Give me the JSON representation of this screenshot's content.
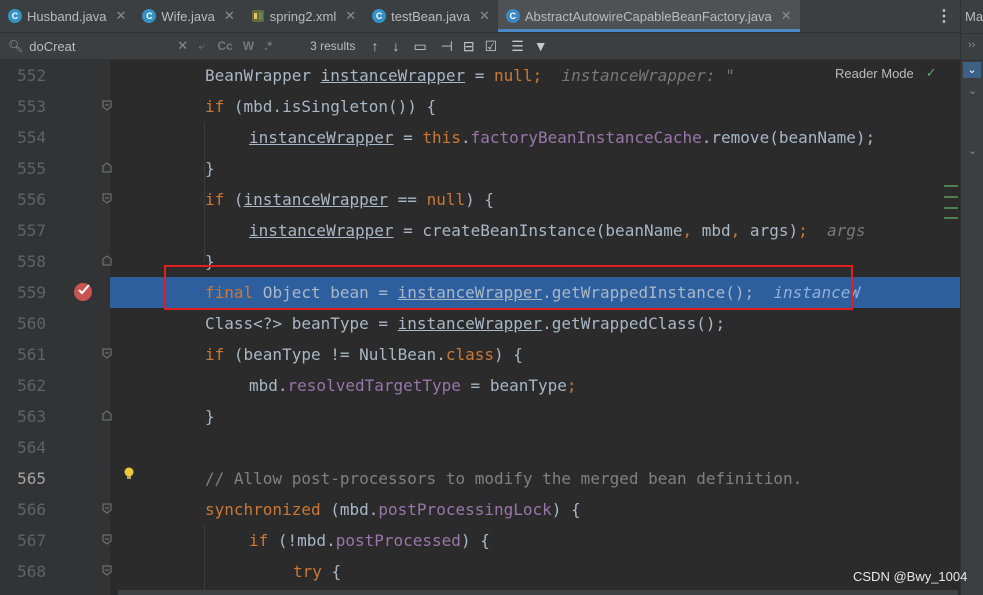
{
  "tabs": [
    {
      "label": "Husband.java",
      "icon": "class-icon",
      "closable": true
    },
    {
      "label": "Wife.java",
      "icon": "class-icon",
      "closable": true
    },
    {
      "label": "spring2.xml",
      "icon": "xml-icon",
      "closable": true
    },
    {
      "label": "testBean.java",
      "icon": "class-icon",
      "closable": true
    },
    {
      "label": "AbstractAutowireCapableBeanFactory.java",
      "icon": "class-icon",
      "closable": true,
      "active": true
    }
  ],
  "tab_menu_glyph": "⋮",
  "right_panel": {
    "label": "Ma"
  },
  "search": {
    "value": "doCreat",
    "match_case": "Cc",
    "words": "W",
    "regex": ".*",
    "results": "3 results"
  },
  "reader_mode": "Reader Mode",
  "line_numbers": [
    "552",
    "553",
    "554",
    "555",
    "556",
    "557",
    "558",
    "559",
    "560",
    "561",
    "562",
    "563",
    "564",
    "565",
    "566",
    "567",
    "568"
  ],
  "current_line": "565",
  "breakpoint_line": "559",
  "code": {
    "l552": {
      "a": "BeanWrapper ",
      "b": "instanceWrapper",
      "c": " = ",
      "d": "null",
      "e": ";",
      "hint": "instanceWrapper: \""
    },
    "l553": {
      "kw": "if",
      "rest": " (mbd.isSingleton()) {"
    },
    "l554": {
      "var": "instanceWrapper",
      "a": " = ",
      "kw": "this",
      "b": ".",
      "fld": "factoryBeanInstanceCache",
      "c": ".remove(beanName);"
    },
    "l555": {
      "text": "}"
    },
    "l556": {
      "kw": "if",
      "a": " (",
      "var": "instanceWrapper",
      "b": " == ",
      "kw2": "null",
      "c": ") {"
    },
    "l557": {
      "var": "instanceWrapper",
      "a": " = createBeanInstance(beanName",
      "comma1": ",",
      "b": " mbd",
      "comma2": ",",
      "c": " args)",
      "semi": ";",
      "hint": "args"
    },
    "l558": {
      "text": "}"
    },
    "l559": {
      "kw": "final",
      "a": " Object bean = ",
      "var": "instanceWrapper",
      "b": ".getWrappedInstance();",
      "hint": "instanceW"
    },
    "l560": {
      "a": "Class<?> beanType = ",
      "var": "instanceWrapper",
      "b": ".getWrappedClass();"
    },
    "l561": {
      "kw": "if",
      "a": " (beanType != NullBean.",
      "kw2": "class",
      "b": ") {"
    },
    "l562": {
      "a": "mbd.",
      "fld": "resolvedTargetType",
      "b": " = beanType",
      "semi": ";"
    },
    "l563": {
      "text": "}"
    },
    "l565": {
      "comment": "// Allow post-processors to modify the merged bean definition."
    },
    "l566": {
      "kw": "synchronized",
      "a": " (mbd.",
      "fld": "postProcessingLock",
      "b": ") {"
    },
    "l567": {
      "kw": "if",
      "a": " (!mbd.",
      "fld": "postProcessed",
      "b": ") {"
    },
    "l568": {
      "kw": "try",
      "a": " {"
    }
  },
  "watermark": "CSDN @Bwy_1004",
  "colors": {
    "keyword": "#cc7832",
    "field": "#9876aa",
    "comment": "#808080",
    "highlight": "#2d5f9e",
    "breakpoint": "#c75450",
    "annotation_box": "#e02020"
  }
}
